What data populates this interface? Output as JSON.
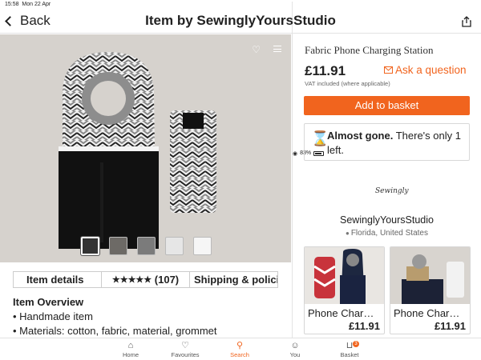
{
  "status": {
    "time": "15:58",
    "date": "Mon 22 Apr",
    "battery": "83%"
  },
  "nav": {
    "back_label": "Back",
    "title": "Item by SewinglyYoursStudio"
  },
  "gallery": {
    "thumbnail_count": 5,
    "selected_index": 0
  },
  "tabs": {
    "details": "Item details",
    "reviews_stars": "★★★★★",
    "reviews_count": "(107)",
    "shipping": "Shipping & polici"
  },
  "overview": {
    "heading": "Item Overview",
    "bullets": [
      "• Handmade item",
      "• Materials: cotton, fabric, material, grommet"
    ]
  },
  "product": {
    "title": "Fabric Phone Charging Station",
    "price": "£11.91",
    "ask_label": "Ask a question",
    "vat_note": "VAT included (where applicable)",
    "basket_label": "Add to basket",
    "stock_bold": "Almost gone.",
    "stock_rest": " There's only 1 left."
  },
  "shop": {
    "logo_text": "Sewingly",
    "name": "SewinglyYoursStudio",
    "location": "Florida, United States"
  },
  "related": [
    {
      "title": "Phone Char…",
      "price": "£11.91"
    },
    {
      "title": "Phone Char…",
      "price": "£11.91"
    }
  ],
  "tabbar": {
    "home": "Home",
    "favourites": "Favourites",
    "search": "Search",
    "you": "You",
    "basket": "Basket",
    "basket_badge": "3"
  },
  "colors": {
    "accent": "#f1641e"
  }
}
